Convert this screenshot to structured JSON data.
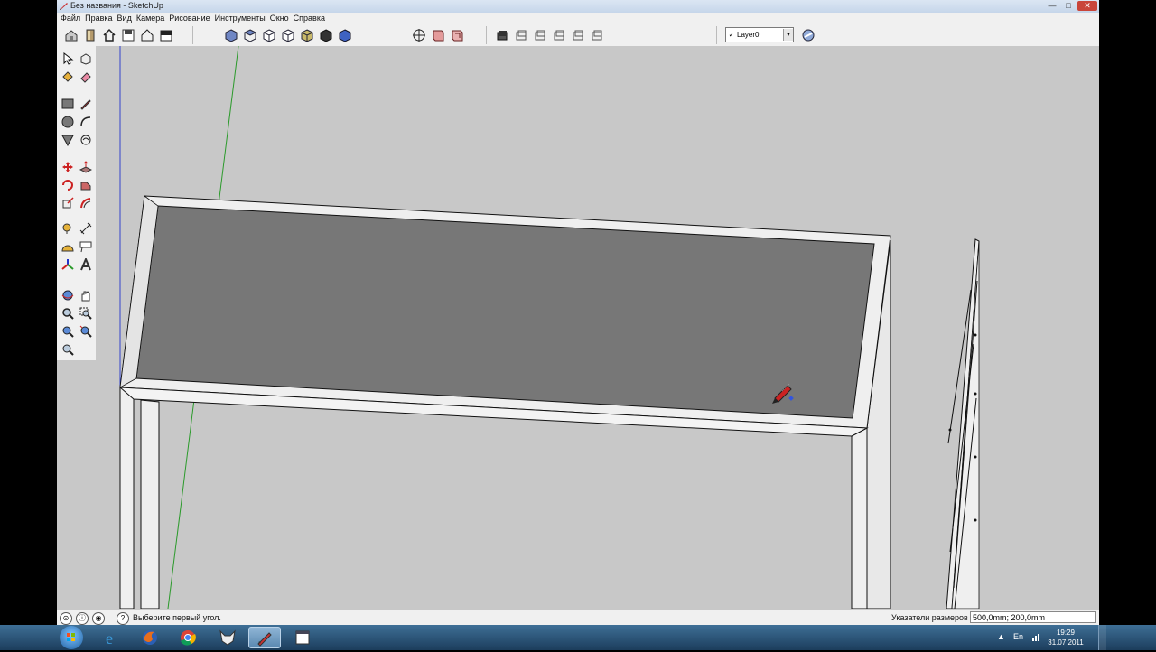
{
  "window": {
    "title": "Без названия - SketchUp",
    "buttons": {
      "minimize": "—",
      "maximize": "□",
      "close": "✕"
    }
  },
  "menu": [
    {
      "label": "Файл"
    },
    {
      "label": "Правка"
    },
    {
      "label": "Вид"
    },
    {
      "label": "Камера"
    },
    {
      "label": "Рисование"
    },
    {
      "label": "Инструменты"
    },
    {
      "label": "Окно"
    },
    {
      "label": "Справка"
    }
  ],
  "layers": {
    "current": "Layer0",
    "checkmark": "✓"
  },
  "status": {
    "hint": "Выберите первый угол.",
    "measure_label": "Указатели размеров",
    "measure_value": "500,0mm; 200,0mm"
  },
  "taskbar": {
    "language": "En",
    "time": "19:29",
    "date": "31.07.2011"
  },
  "colors": {
    "viewport_bg": "#c8c8c8",
    "face_dark": "#777777",
    "face_light": "#efefef",
    "green_axis": "#2a9a2a",
    "blue_axis": "#3344cc"
  },
  "icons": {
    "toolbar_views": [
      "iso-view-icon",
      "top-view-icon",
      "front-view-icon",
      "right-view-icon",
      "back-view-icon",
      "left-view-icon"
    ],
    "toolbar_styles": [
      "xray-icon",
      "wireframe-icon",
      "hidden-line-icon",
      "shaded-icon",
      "shaded-textures-icon",
      "monochrome-icon"
    ]
  }
}
